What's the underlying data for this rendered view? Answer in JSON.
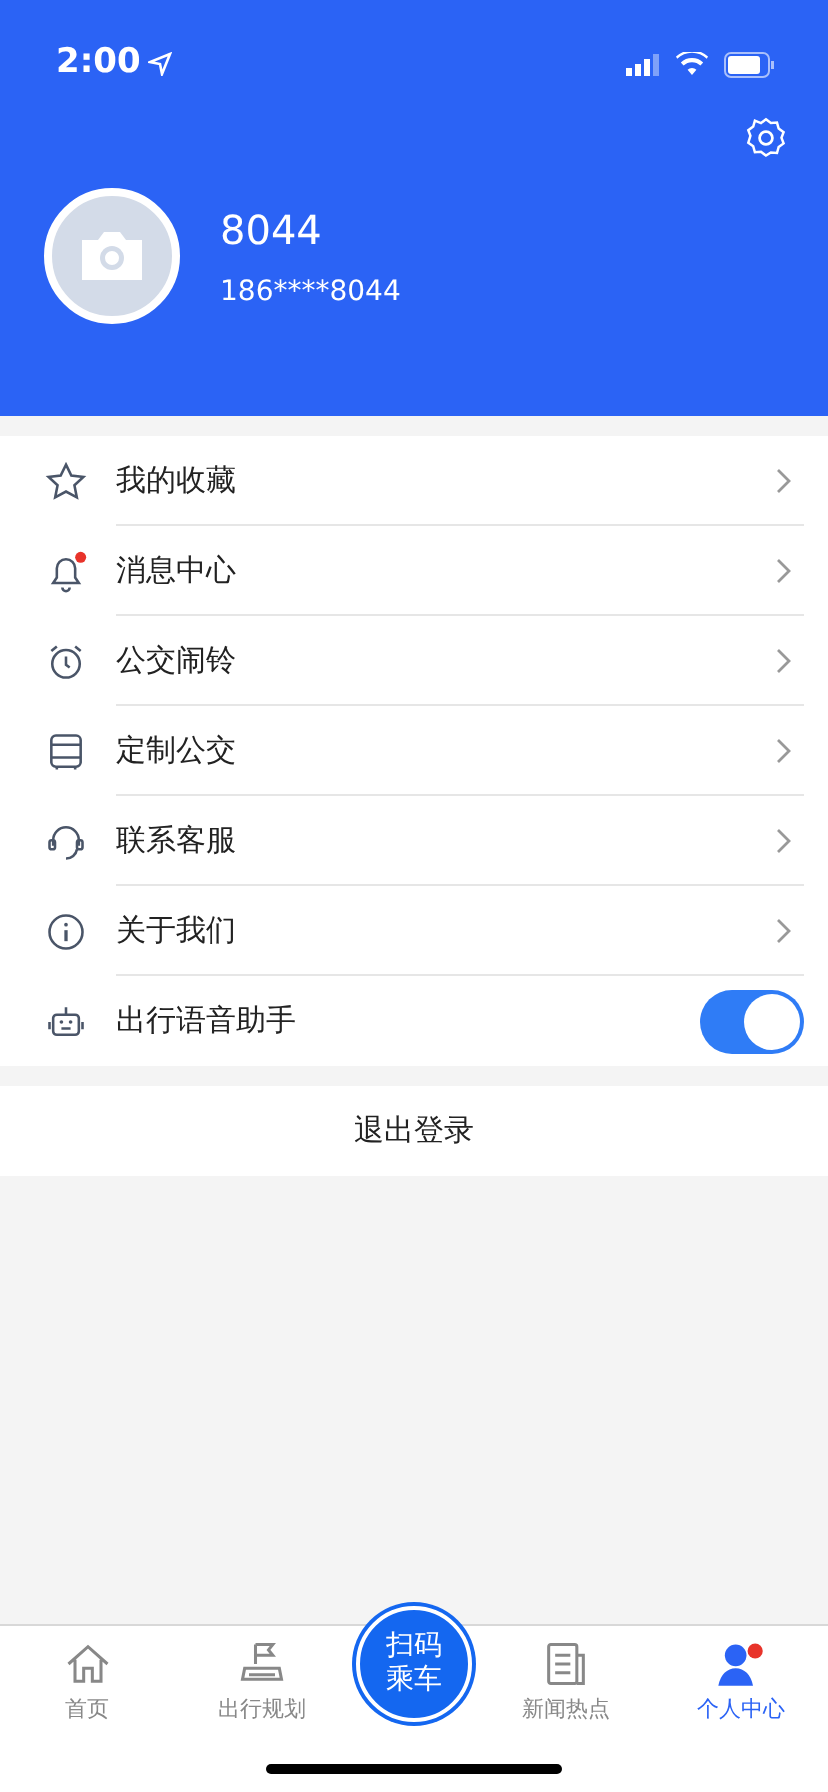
{
  "status_bar": {
    "time": "2:00"
  },
  "profile": {
    "name": "8044",
    "phone": "186****8044"
  },
  "menu": [
    {
      "kind": "link",
      "label": "我的收藏",
      "dot": false
    },
    {
      "kind": "link",
      "label": "消息中心",
      "dot": true
    },
    {
      "kind": "link",
      "label": "公交闹铃",
      "dot": false
    },
    {
      "kind": "link",
      "label": "定制公交",
      "dot": false
    },
    {
      "kind": "link",
      "label": "联系客服",
      "dot": false
    },
    {
      "kind": "link",
      "label": "关于我们",
      "dot": false
    },
    {
      "kind": "toggle",
      "label": "出行语音助手",
      "dot": false,
      "on": true
    }
  ],
  "logout": "退出登录",
  "tabs": [
    {
      "kind": "tab",
      "label": "首页",
      "selected": false
    },
    {
      "kind": "tab",
      "label": "出行规划",
      "selected": false
    },
    {
      "kind": "scan",
      "label": "扫码乘车",
      "selected": false
    },
    {
      "kind": "tab",
      "label": "新闻热点",
      "selected": false
    },
    {
      "kind": "tab",
      "label": "个人中心",
      "selected": true
    }
  ]
}
